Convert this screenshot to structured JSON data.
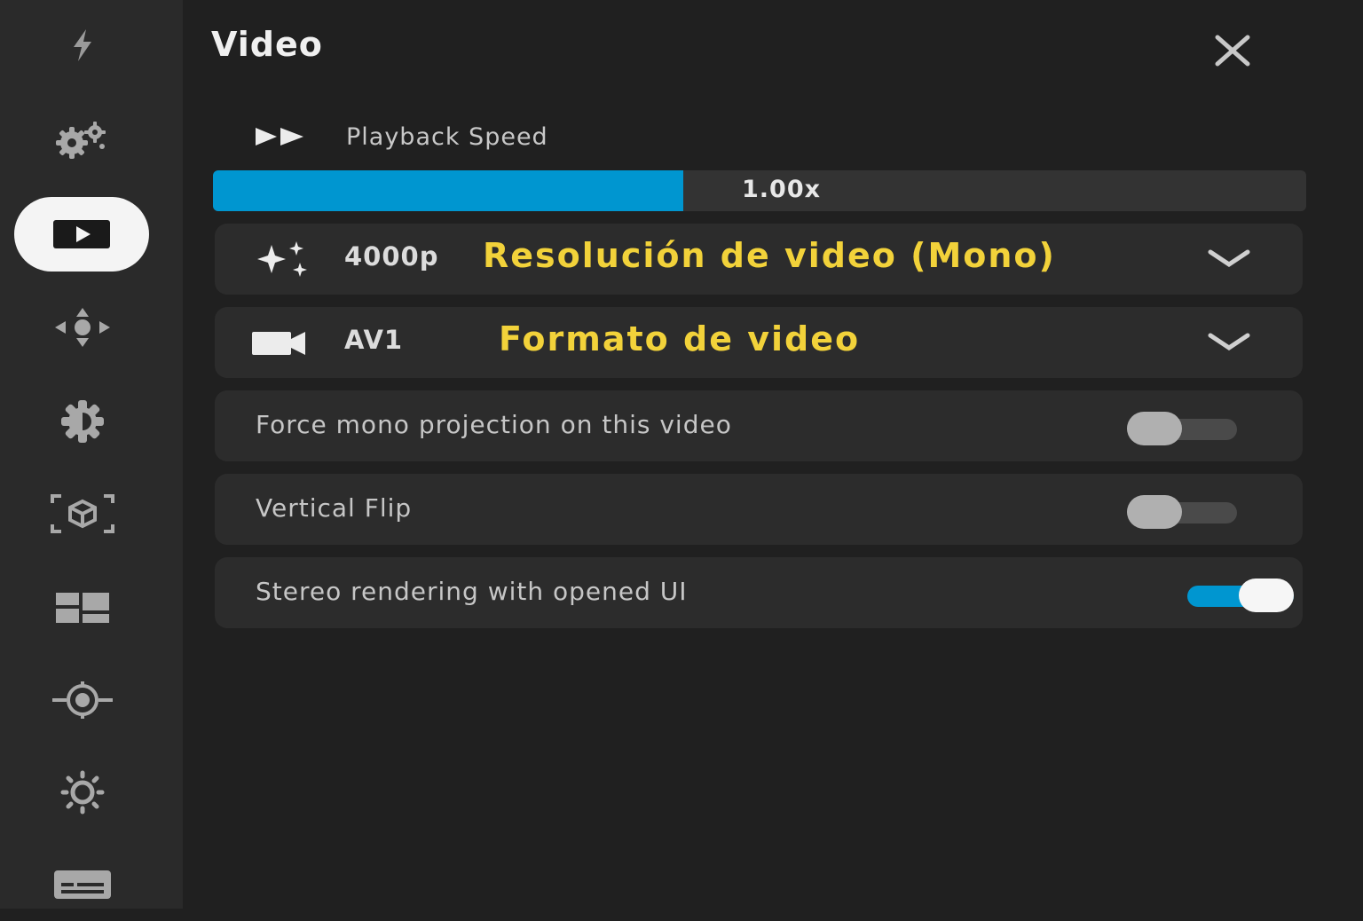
{
  "sidebar": {
    "items": [
      {
        "icon": "bolt-icon",
        "active": false
      },
      {
        "icon": "gears-icon",
        "active": false
      },
      {
        "icon": "video-play-icon",
        "active": true
      },
      {
        "icon": "move-arrows-icon",
        "active": false
      },
      {
        "icon": "gear-icon",
        "active": false
      },
      {
        "icon": "3d-cube-scan-icon",
        "active": false
      },
      {
        "icon": "dashboard-icon",
        "active": false
      },
      {
        "icon": "target-icon",
        "active": false
      },
      {
        "icon": "brightness-icon",
        "active": false
      },
      {
        "icon": "subtitles-icon",
        "active": false
      }
    ]
  },
  "panel": {
    "title": "Video",
    "playback_speed": {
      "label": "Playback Speed",
      "value_label": "1.00x",
      "fill_fraction": 0.43
    },
    "resolution": {
      "value": "4000p",
      "overlay": "Resolución de video (Mono)"
    },
    "format": {
      "value": "AV1",
      "overlay": "Formato de video"
    },
    "toggles": [
      {
        "label": "Force mono projection on this video",
        "on": false
      },
      {
        "label": "Vertical Flip",
        "on": false
      },
      {
        "label": "Stereo rendering with opened UI",
        "on": true
      }
    ]
  },
  "colors": {
    "accent": "#0096d0",
    "overlay_text": "#f2d23a",
    "background": "#202020",
    "sidebar": "#2a2a2a"
  }
}
